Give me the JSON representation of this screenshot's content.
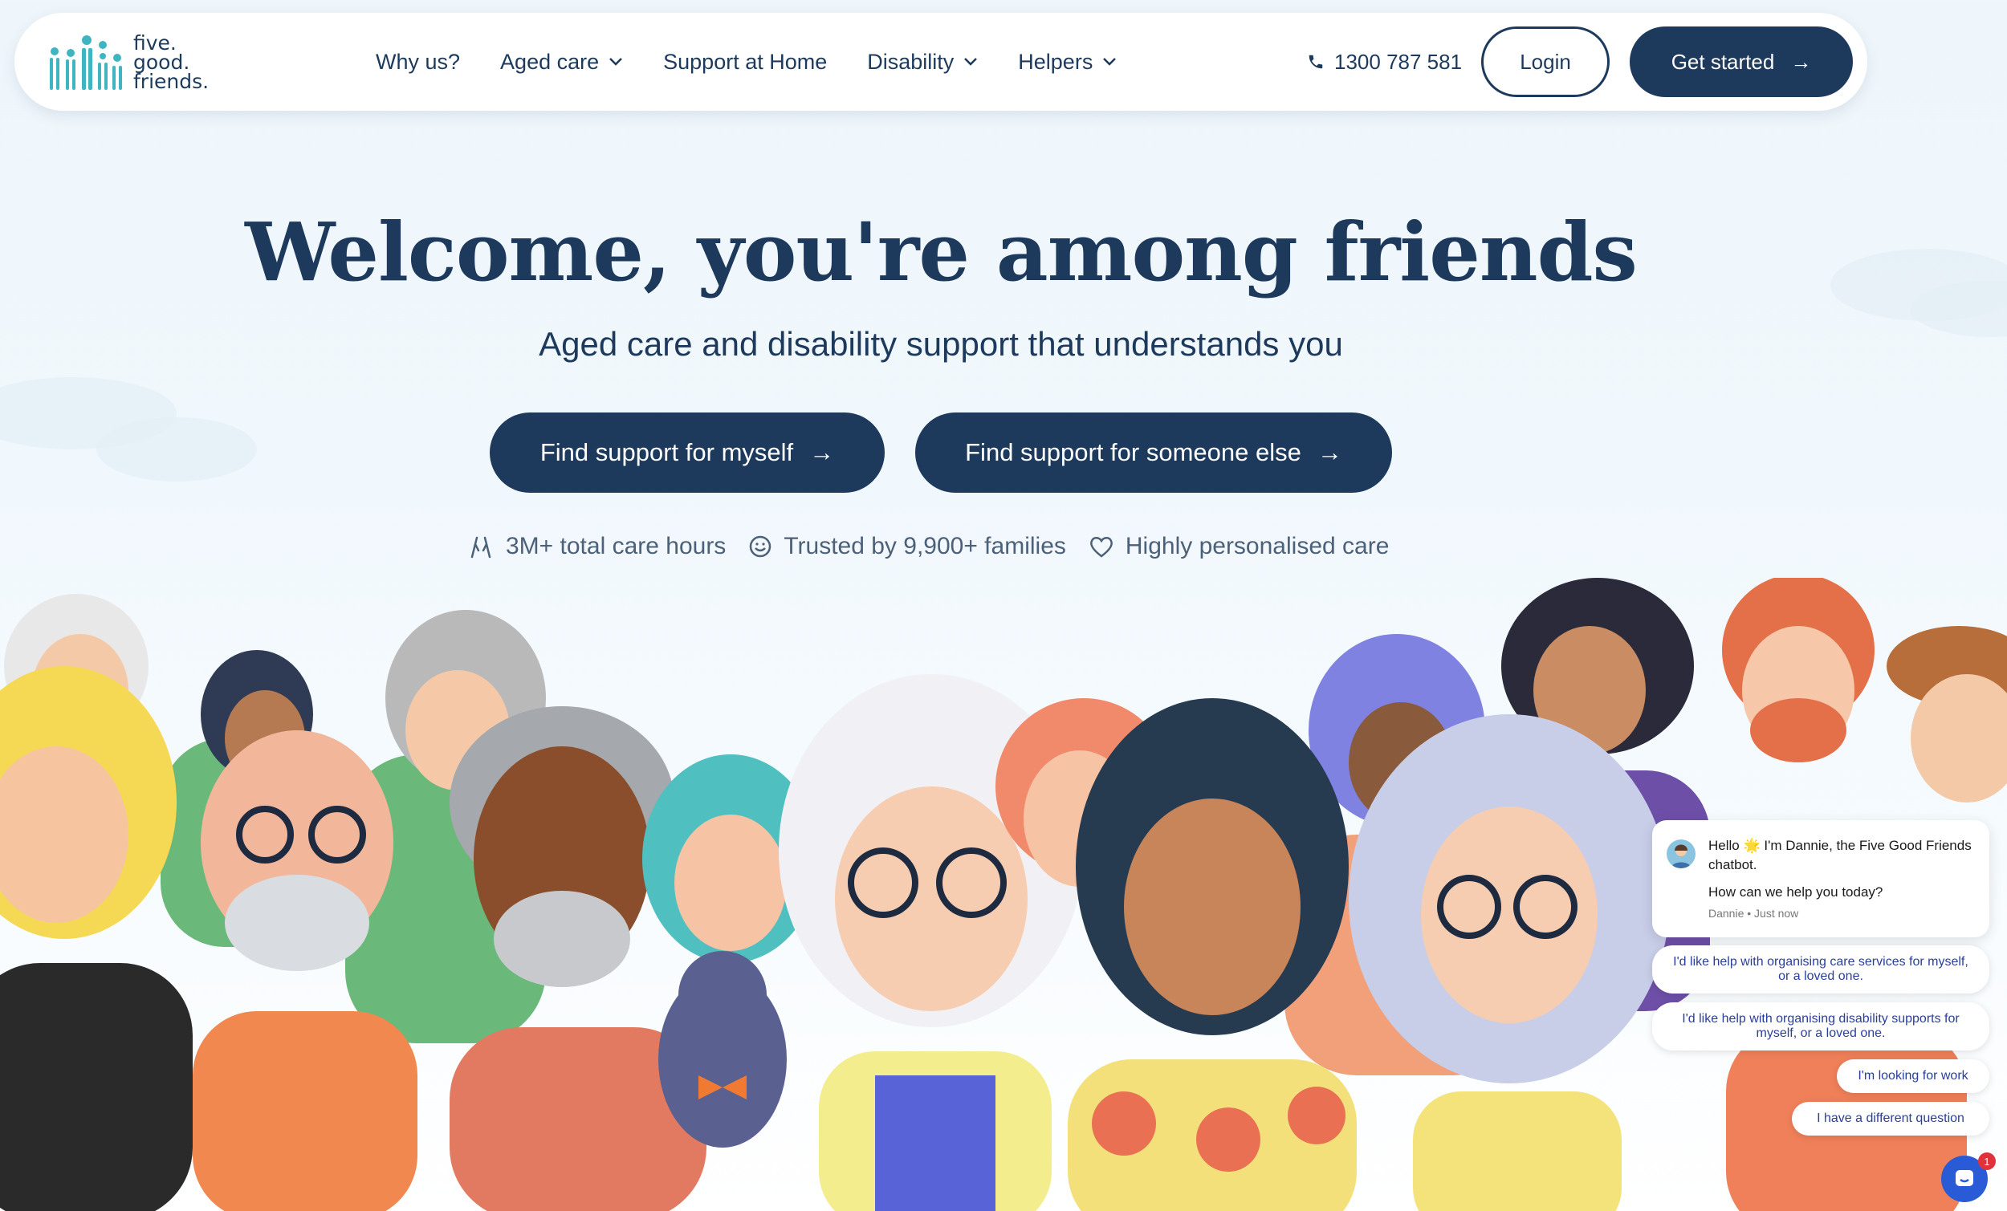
{
  "brand": {
    "logo_lines": [
      "five.",
      "good.",
      "friends."
    ],
    "primary_color": "#1d3a5c",
    "logo_color": "#3fb5c2"
  },
  "nav": {
    "links": [
      {
        "label": "Why us?",
        "has_dropdown": false
      },
      {
        "label": "Aged care",
        "has_dropdown": true
      },
      {
        "label": "Support at Home",
        "has_dropdown": false
      },
      {
        "label": "Disability",
        "has_dropdown": true
      },
      {
        "label": "Helpers",
        "has_dropdown": true
      }
    ],
    "phone": "1300 787 581",
    "login_label": "Login",
    "cta_label": "Get started"
  },
  "hero": {
    "title": "Welcome, you're among friends",
    "subtitle": "Aged care and disability support that understands you",
    "buttons": [
      {
        "label": "Find support for myself"
      },
      {
        "label": "Find support for someone else"
      }
    ],
    "stats": [
      {
        "icon": "hands-icon",
        "text": "3M+ total care hours"
      },
      {
        "icon": "smile-icon",
        "text": "Trusted by 9,900+ families"
      },
      {
        "icon": "heart-icon",
        "text": "Highly personalised care"
      }
    ]
  },
  "chat": {
    "greeting": "Hello 🌟 I'm Dannie, the Five Good Friends chatbot.",
    "question": "How can we help you today?",
    "meta": "Dannie • Just now",
    "options": [
      "I'd like help with organising care services for myself, or a loved one.",
      "I'd like help with organising disability supports for myself, or a loved one.",
      "I'm looking for work",
      "I have a different question"
    ],
    "unread_count": "1"
  }
}
